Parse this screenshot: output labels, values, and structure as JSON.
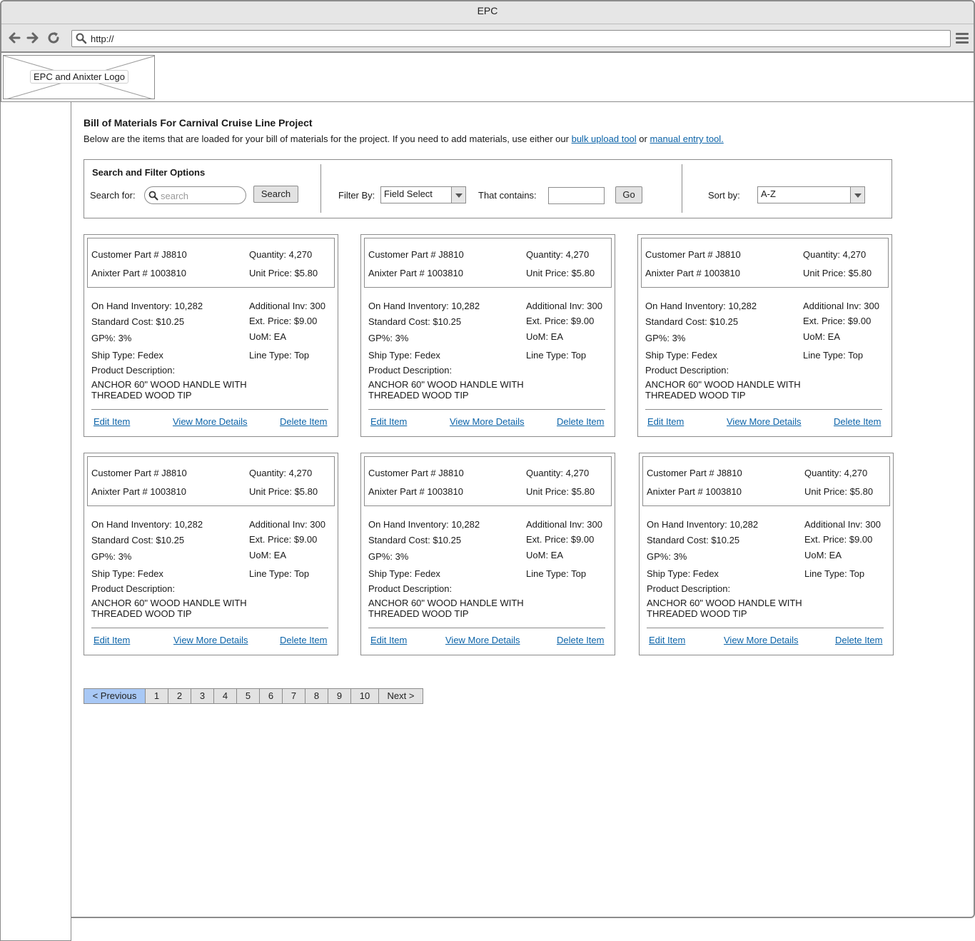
{
  "window": {
    "title": "EPC"
  },
  "browser": {
    "address": "http://"
  },
  "header": {
    "logo_label": "EPC and Anixter Logo"
  },
  "page": {
    "title": "Bill of Materials For Carnival Cruise Line Project",
    "intro_text": "Below are the items that are loaded for your bill of materials for the project. If you need to add materials, use either our ",
    "bulk_link": "bulk upload tool",
    "or_text": " or ",
    "manual_link": "manual entry tool."
  },
  "filters": {
    "heading": "Search and Filter Options",
    "search_label": "Search for:",
    "search_placeholder": "search",
    "search_button": "Search",
    "filter_label": "Filter By:",
    "filter_value": "Field Select",
    "contains_label": "That contains:",
    "contains_value": "",
    "go_button": "Go",
    "sort_label": "Sort by:",
    "sort_value": "A-Z"
  },
  "items": [
    {
      "customer_part": "Customer Part # J8810",
      "quantity": "Quantity: 4,270",
      "anixter_part": "Anixter Part # 1003810",
      "unit_price": "Unit Price: $5.80",
      "on_hand": "On Hand Inventory: 10,282",
      "additional": "Additional  Inv: 300",
      "standard_cost": "Standard Cost: $10.25",
      "ext_price": "Ext. Price: $9.00",
      "gp": "GP%: 3%",
      "uom": "UoM: EA",
      "ship_type": "Ship Type: Fedex",
      "line_type": "Line Type: Top",
      "desc_label": "Product Description:",
      "desc": "ANCHOR 60\" WOOD HANDLE WITH THREADED WOOD TIP",
      "edit": "Edit Item",
      "details": "View More Details",
      "delete": "Delete Item"
    },
    {
      "customer_part": "Customer Part # J8810",
      "quantity": "Quantity: 4,270",
      "anixter_part": "Anixter Part # 1003810",
      "unit_price": "Unit Price: $5.80",
      "on_hand": "On Hand Inventory: 10,282",
      "additional": "Additional  Inv: 300",
      "standard_cost": "Standard Cost: $10.25",
      "ext_price": "Ext. Price: $9.00",
      "gp": "GP%: 3%",
      "uom": "UoM: EA",
      "ship_type": "Ship Type: Fedex",
      "line_type": "Line Type: Top",
      "desc_label": "Product Description:",
      "desc": "ANCHOR 60\" WOOD HANDLE WITH THREADED WOOD TIP",
      "edit": "Edit Item",
      "details": "View More Details",
      "delete": "Delete Item"
    },
    {
      "customer_part": "Customer Part # J8810",
      "quantity": "Quantity: 4,270",
      "anixter_part": "Anixter Part # 1003810",
      "unit_price": "Unit Price: $5.80",
      "on_hand": "On Hand Inventory: 10,282",
      "additional": "Additional  Inv: 300",
      "standard_cost": "Standard Cost: $10.25",
      "ext_price": "Ext. Price: $9.00",
      "gp": "GP%: 3%",
      "uom": "UoM: EA",
      "ship_type": "Ship Type: Fedex",
      "line_type": "Line Type: Top",
      "desc_label": "Product Description:",
      "desc": "ANCHOR 60\" WOOD HANDLE WITH THREADED WOOD TIP",
      "edit": "Edit Item",
      "details": "View More Details",
      "delete": "Delete Item"
    },
    {
      "customer_part": "Customer Part # J8810",
      "quantity": "Quantity: 4,270",
      "anixter_part": "Anixter Part # 1003810",
      "unit_price": "Unit Price: $5.80",
      "on_hand": "On Hand Inventory: 10,282",
      "additional": "Additional  Inv: 300",
      "standard_cost": "Standard Cost: $10.25",
      "ext_price": "Ext. Price: $9.00",
      "gp": "GP%: 3%",
      "uom": "UoM: EA",
      "ship_type": "Ship Type: Fedex",
      "line_type": "Line Type: Top",
      "desc_label": "Product Description:",
      "desc": "ANCHOR 60\" WOOD HANDLE WITH THREADED WOOD TIP",
      "edit": "Edit Item",
      "details": "View More Details",
      "delete": "Delete Item"
    },
    {
      "customer_part": "Customer Part # J8810",
      "quantity": "Quantity: 4,270",
      "anixter_part": "Anixter Part # 1003810",
      "unit_price": "Unit Price: $5.80",
      "on_hand": "On Hand Inventory: 10,282",
      "additional": "Additional  Inv: 300",
      "standard_cost": "Standard Cost: $10.25",
      "ext_price": "Ext. Price: $9.00",
      "gp": "GP%: 3%",
      "uom": "UoM: EA",
      "ship_type": "Ship Type: Fedex",
      "line_type": "Line Type: Top",
      "desc_label": "Product Description:",
      "desc": "ANCHOR 60\" WOOD HANDLE WITH THREADED WOOD TIP",
      "edit": "Edit Item",
      "details": "View More Details",
      "delete": "Delete Item"
    },
    {
      "customer_part": "Customer Part # J8810",
      "quantity": "Quantity: 4,270",
      "anixter_part": "Anixter Part # 1003810",
      "unit_price": "Unit Price: $5.80",
      "on_hand": "On Hand Inventory: 10,282",
      "additional": "Additional  Inv: 300",
      "standard_cost": "Standard Cost: $10.25",
      "ext_price": "Ext. Price: $9.00",
      "gp": "GP%: 3%",
      "uom": "UoM: EA",
      "ship_type": "Ship Type: Fedex",
      "line_type": "Line Type: Top",
      "desc_label": "Product Description:",
      "desc": "ANCHOR 60\" WOOD HANDLE WITH THREADED WOOD TIP",
      "edit": "Edit Item",
      "details": "View More Details",
      "delete": "Delete Item"
    }
  ],
  "pagination": {
    "previous": "< Previous",
    "pages": [
      "1",
      "2",
      "3",
      "4",
      "5",
      "6",
      "7",
      "8",
      "9",
      "10"
    ],
    "next": "Next >"
  },
  "colors": {
    "link": "#0b63a8",
    "border": "#8c8c8c",
    "chrome": "#e6e6e6",
    "active_page": "#a8c8f5"
  }
}
